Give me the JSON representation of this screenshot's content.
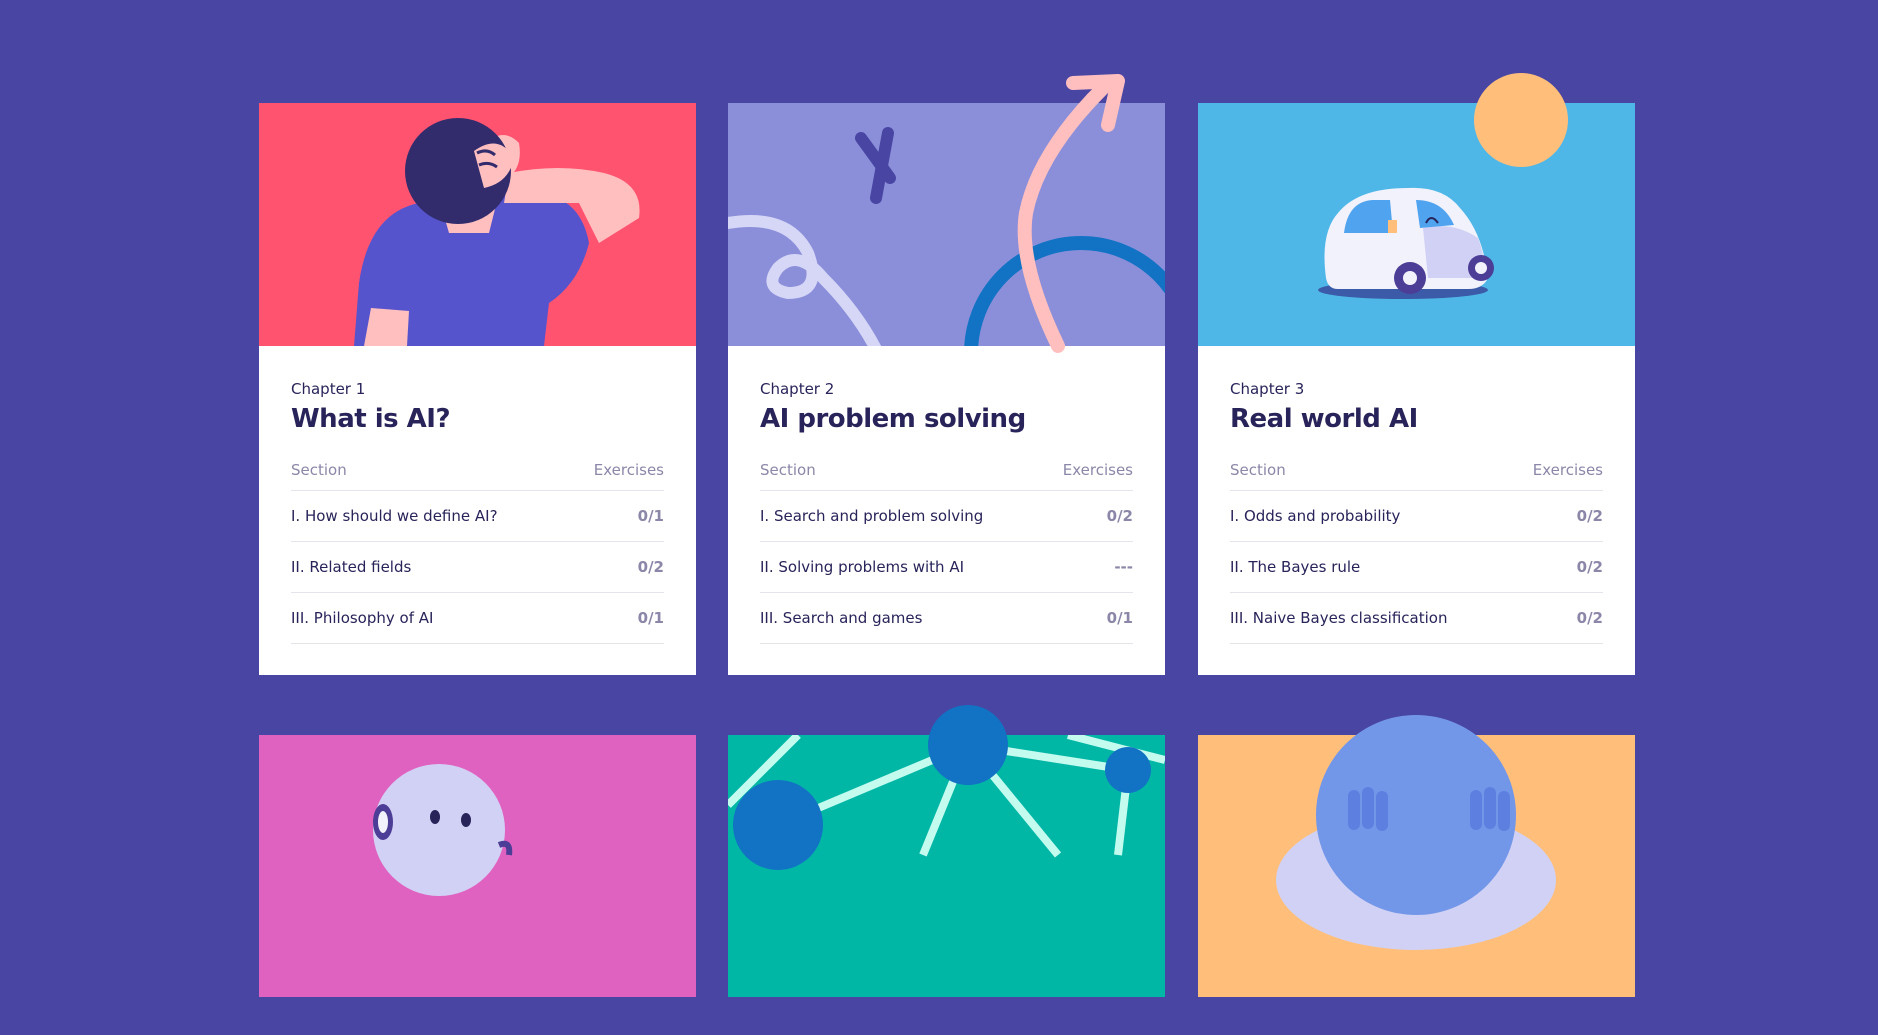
{
  "cards": [
    {
      "chapter": "Chapter 1",
      "title": "What is AI?",
      "section_header": "Section",
      "exercises_header": "Exercises",
      "rows": [
        {
          "label": "I. How should we define AI?",
          "score": "0/1"
        },
        {
          "label": "II. Related fields",
          "score": "0/2"
        },
        {
          "label": "III. Philosophy of AI",
          "score": "0/1"
        }
      ],
      "hero_color": "#ff5370"
    },
    {
      "chapter": "Chapter 2",
      "title": "AI problem solving",
      "section_header": "Section",
      "exercises_header": "Exercises",
      "rows": [
        {
          "label": "I. Search and problem solving",
          "score": "0/2"
        },
        {
          "label": "II. Solving problems with AI",
          "score": "---"
        },
        {
          "label": "III. Search and games",
          "score": "0/1"
        }
      ],
      "hero_color": "#8b8fd9"
    },
    {
      "chapter": "Chapter 3",
      "title": "Real world AI",
      "section_header": "Section",
      "exercises_header": "Exercises",
      "rows": [
        {
          "label": "I. Odds and probability",
          "score": "0/2"
        },
        {
          "label": "II. The Bayes rule",
          "score": "0/2"
        },
        {
          "label": "III. Naive Bayes classification",
          "score": "0/2"
        }
      ],
      "hero_color": "#4fb7e8"
    }
  ],
  "colors": {
    "background": "#4845a3",
    "card4": "#e062c0",
    "card5": "#00b7a6",
    "card6": "#ffbf7a"
  }
}
